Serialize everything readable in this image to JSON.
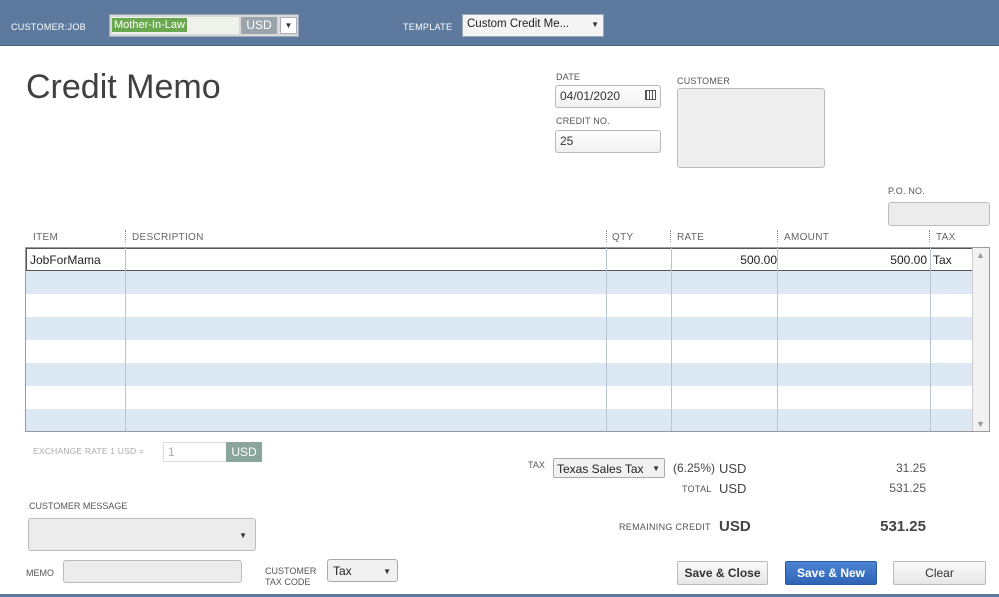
{
  "topbar": {
    "customer_job_label": "CUSTOMER:JOB",
    "customer_job_value": "Mother-In-Law",
    "currency": "USD",
    "template_label": "TEMPLATE",
    "template_value": "Custom Credit Me..."
  },
  "header": {
    "title": "Credit Memo",
    "date_label": "DATE",
    "date_value": "04/01/2020",
    "credit_no_label": "CREDIT NO.",
    "credit_no_value": "25",
    "customer_label": "CUSTOMER",
    "po_label": "P.O. NO."
  },
  "table": {
    "columns": [
      "ITEM",
      "DESCRIPTION",
      "QTY",
      "RATE",
      "AMOUNT",
      "TAX"
    ],
    "rows": [
      {
        "item": "JobForMama",
        "description": "",
        "qty": "",
        "rate": "500.00",
        "amount": "500.00",
        "tax": "Tax"
      }
    ]
  },
  "footer": {
    "exchange_rate_label": "EXCHANGE RATE 1 USD =",
    "exchange_rate_value": "1",
    "exchange_currency": "USD",
    "tax_label": "TAX",
    "tax_item": "Texas Sales Tax",
    "tax_rate": "(6.25%)",
    "tax_currency": "USD",
    "tax_amount": "31.25",
    "total_label": "TOTAL",
    "total_currency": "USD",
    "total_amount": "531.25",
    "remaining_credit_label": "REMAINING CREDIT",
    "remaining_currency": "USD",
    "remaining_amount": "531.25",
    "customer_message_label": "CUSTOMER MESSAGE",
    "memo_label": "MEMO",
    "customer_tax_code_label_1": "CUSTOMER",
    "customer_tax_code_label_2": "TAX CODE",
    "customer_tax_code_value": "Tax"
  },
  "buttons": {
    "save_close": "Save & Close",
    "save_new": "Save & New",
    "clear": "Clear"
  },
  "colors": {
    "topbar": "#5d7a9e",
    "row_stripe": "#dce8f4",
    "primary_button": "#2e63b5"
  }
}
